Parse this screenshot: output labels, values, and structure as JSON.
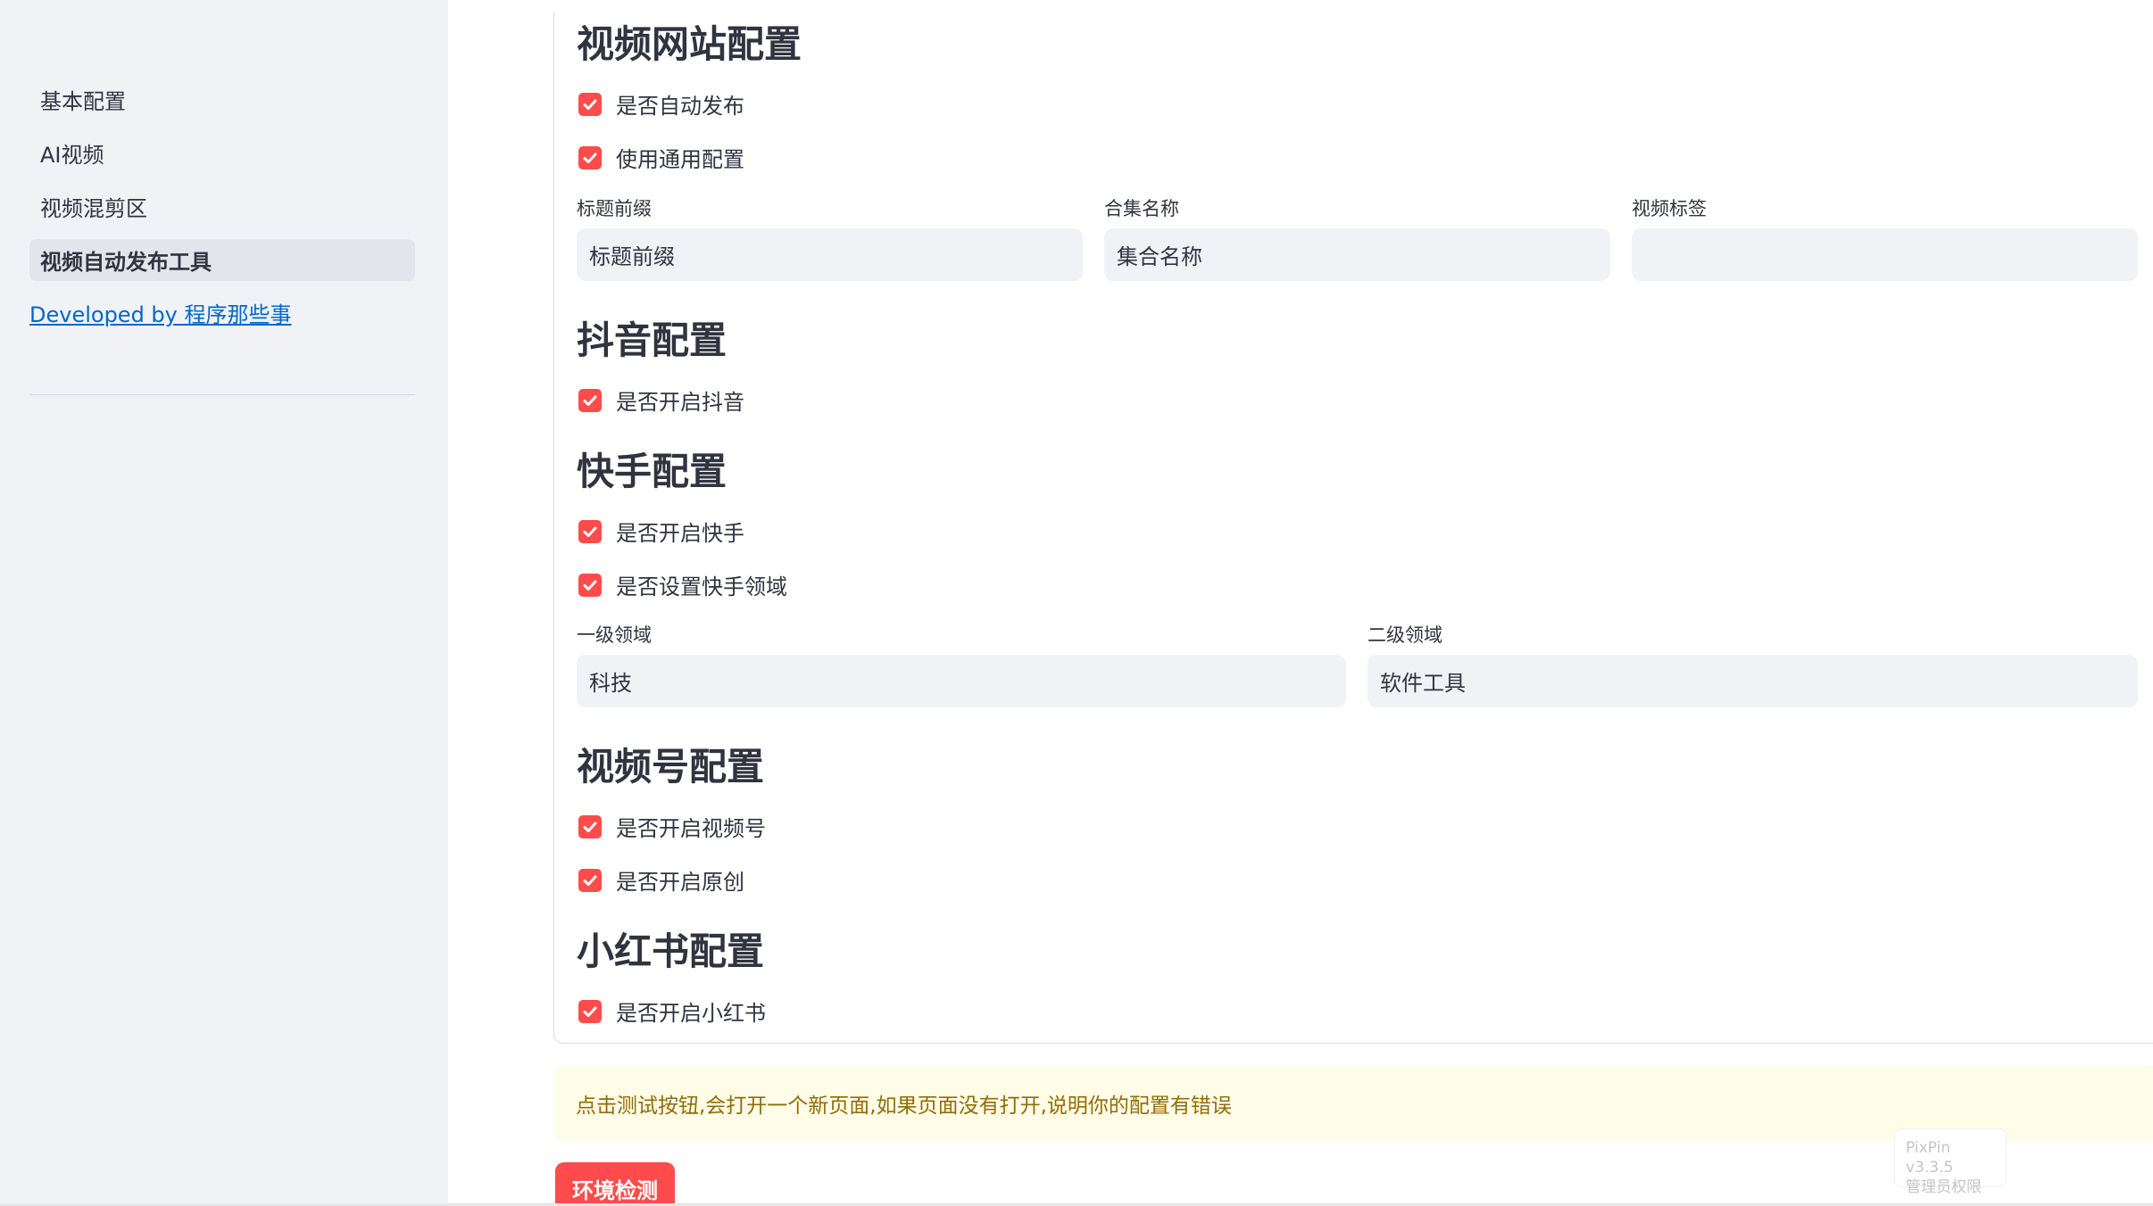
{
  "sidebar": {
    "items": [
      {
        "label": "基本配置"
      },
      {
        "label": "AI视频"
      },
      {
        "label": "视频混剪区"
      },
      {
        "label": "视频自动发布工具"
      }
    ],
    "footer_link": "Developed by 程序那些事"
  },
  "main": {
    "website": {
      "title": "视频网站配置",
      "auto_publish": "是否自动发布",
      "use_common": "使用通用配置",
      "title_prefix_label": "标题前缀",
      "title_prefix_value": "标题前缀",
      "collection_label": "合集名称",
      "collection_value": "集合名称",
      "tags_label": "视频标签",
      "tags_value": ""
    },
    "douyin": {
      "title": "抖音配置",
      "enable": "是否开启抖音"
    },
    "kuaishou": {
      "title": "快手配置",
      "enable": "是否开启快手",
      "set_domain": "是否设置快手领域",
      "level1_label": "一级领域",
      "level1_value": "科技",
      "level2_label": "二级领域",
      "level2_value": "软件工具"
    },
    "shipinhao": {
      "title": "视频号配置",
      "enable": "是否开启视频号",
      "original": "是否开启原创"
    },
    "xiaohongshu": {
      "title": "小红书配置",
      "enable": "是否开启小红书"
    },
    "alert": "点击测试按钮,会打开一个新页面,如果页面没有打开,说明你的配置有错误",
    "env_button": "环境检测"
  },
  "watermark": {
    "line1": "PixPin v3.3.5",
    "line2": "管理员权限"
  },
  "colors": {
    "accent": "#ff4b4b",
    "sidebar_bg": "#f0f2f6",
    "input_bg": "#f0f2f6",
    "alert_bg": "#fffce7",
    "alert_text": "#926c05",
    "link": "#0068c9"
  },
  "checkbox_icon": "check-icon"
}
